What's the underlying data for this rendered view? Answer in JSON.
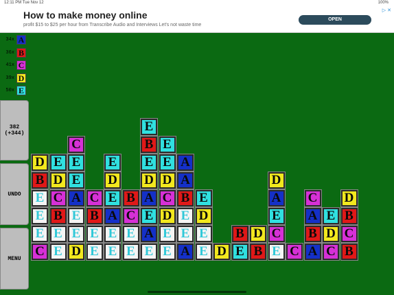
{
  "status": {
    "time": "12:11 PM  Tue Nov 12",
    "battery": "100%"
  },
  "ad": {
    "title": "How to make money online",
    "description": "profit $15 to $25 per hour from Transcribe Audio and Interviews Let's not waste time",
    "button": "OPEN",
    "badge": "▷ ✕"
  },
  "colors": {
    "A": {
      "bg": "#1430c8",
      "fg": "#0a0a0a"
    },
    "B": {
      "bg": "#e01818",
      "fg": "#0a0a0a"
    },
    "C": {
      "bg": "#d630d6",
      "fg": "#0a0a0a"
    },
    "D": {
      "bg": "#f2e81e",
      "fg": "#0a0a0a"
    },
    "E": {
      "bg": "#30e0e0",
      "fg": "#0a0a0a"
    },
    "e": {
      "bg": "#f4f4f4",
      "fg": "#30c8d8"
    }
  },
  "legend": [
    {
      "count": "34x",
      "letter": "A"
    },
    {
      "count": "36x",
      "letter": "B"
    },
    {
      "count": "41x",
      "letter": "C"
    },
    {
      "count": "39x",
      "letter": "D"
    },
    {
      "count": "50x",
      "letter": "E"
    }
  ],
  "score": {
    "value": "382",
    "delta": "(+344)"
  },
  "buttons": {
    "undo": "UNDO",
    "menu": "MENU"
  },
  "board": {
    "columns": [
      [
        "C",
        "e",
        "e",
        "e",
        "B",
        "D"
      ],
      [
        "e",
        "e",
        "B",
        "C",
        "D",
        "E"
      ],
      [
        "D",
        "e",
        "e",
        "A",
        "E",
        "E",
        "C"
      ],
      [
        "e",
        "e",
        "B",
        "C"
      ],
      [
        "e",
        "e",
        "A",
        "E",
        "D",
        "E"
      ],
      [
        "e",
        "e",
        "C",
        "B"
      ],
      [
        "e",
        "A",
        "E",
        "A",
        "D",
        "E",
        "B",
        "E"
      ],
      [
        "e",
        "e",
        "D",
        "C",
        "D",
        "E",
        "E"
      ],
      [
        "A",
        "e",
        "e",
        "B",
        "A",
        "A"
      ],
      [
        "e",
        "e",
        "D",
        "E"
      ],
      [
        "D"
      ],
      [
        "E",
        "B"
      ],
      [
        "B",
        "D"
      ],
      [
        "e",
        "C",
        "E",
        "A",
        "D"
      ],
      [
        "C"
      ],
      [
        "A",
        "B",
        "A",
        "C"
      ],
      [
        "C",
        "D",
        "E"
      ],
      [
        "B",
        "C",
        "B",
        "D"
      ]
    ]
  }
}
